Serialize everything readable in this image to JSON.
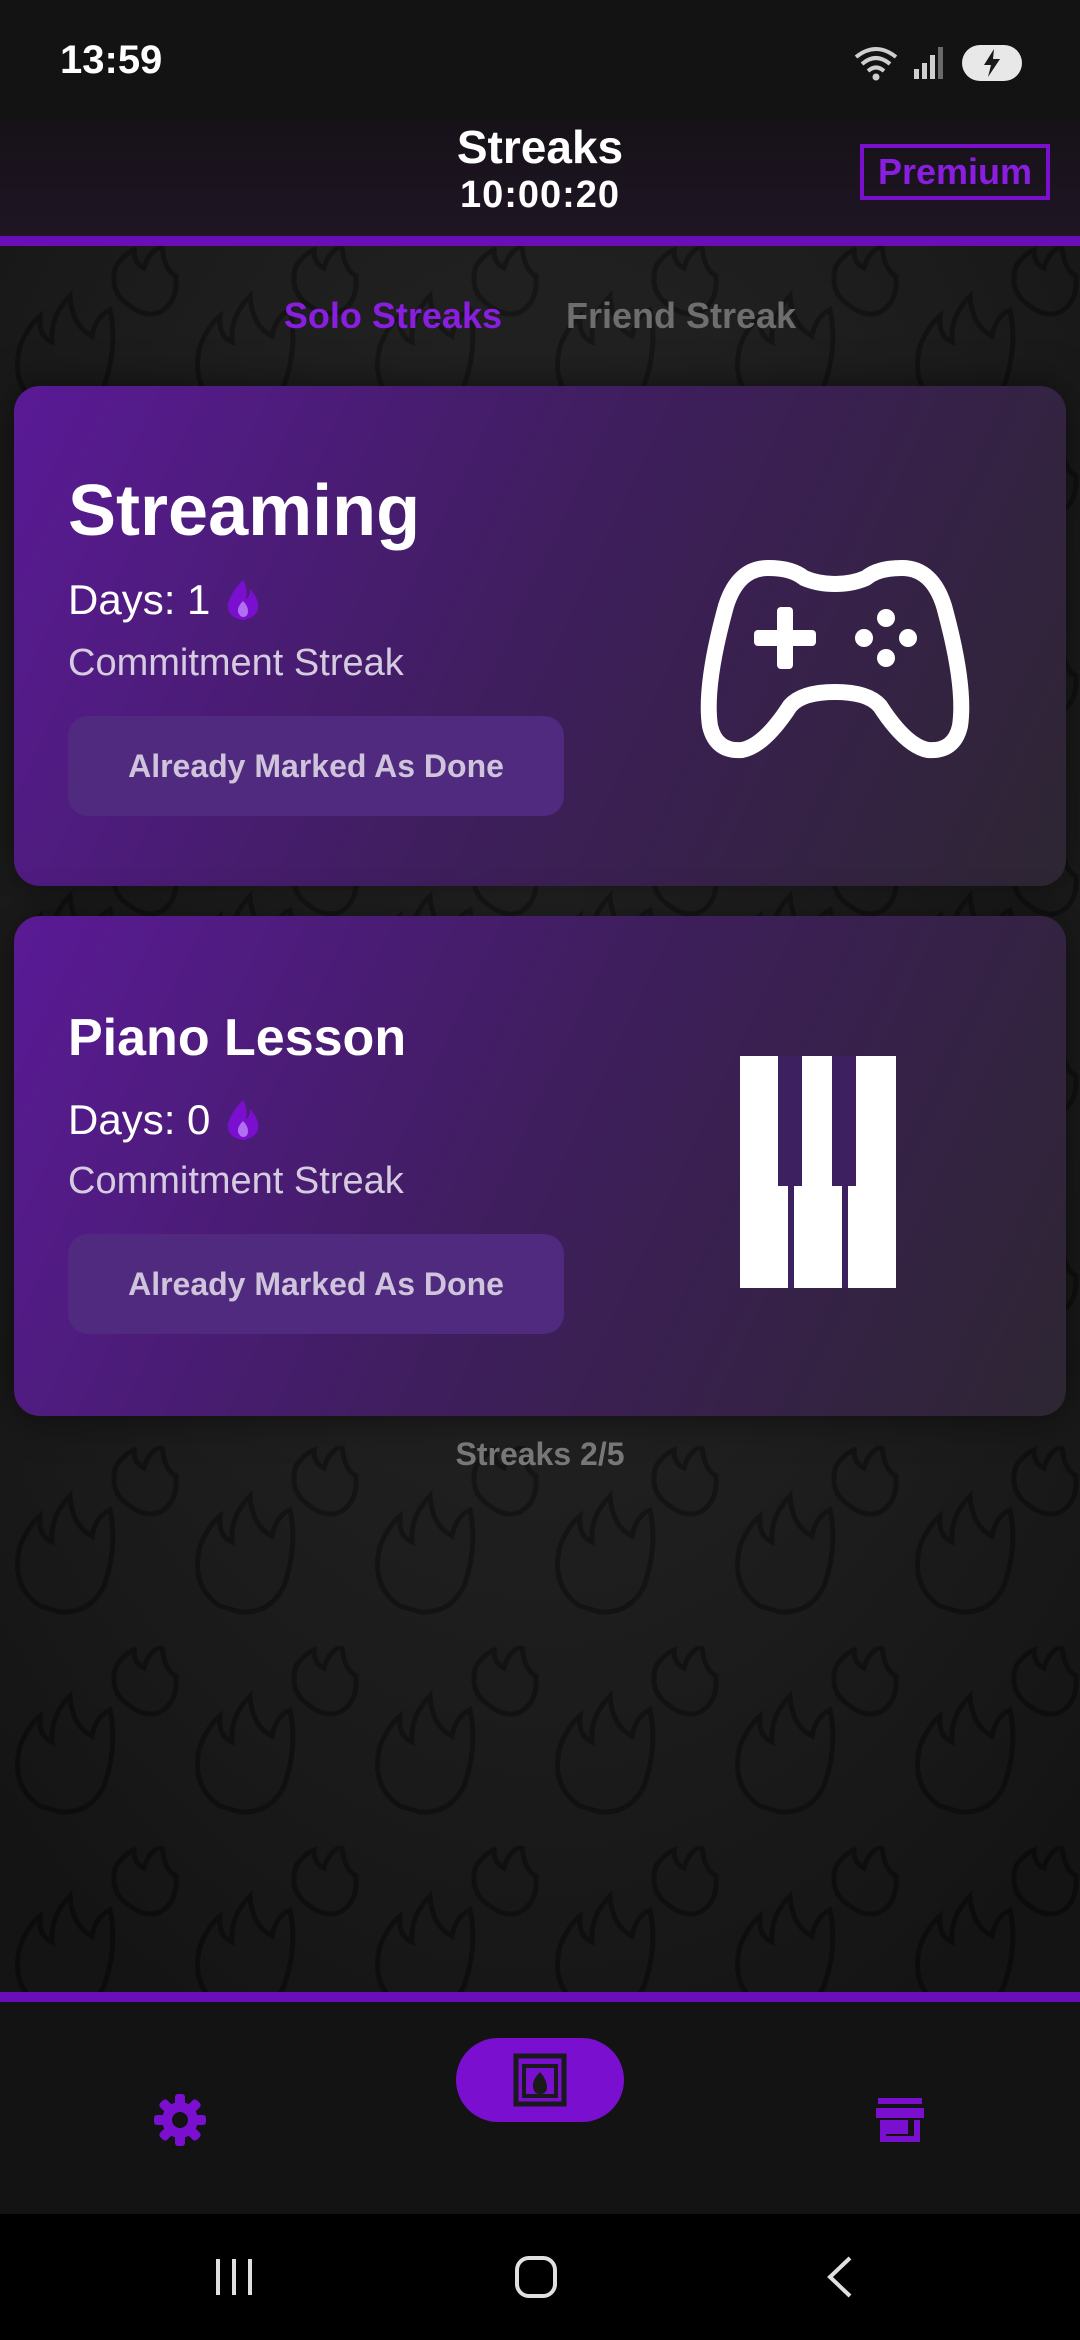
{
  "status_bar": {
    "time": "13:59",
    "icons": [
      "wifi-icon",
      "signal-icon",
      "battery-charging-icon"
    ]
  },
  "header": {
    "title": "Streaks",
    "timer": "10:00:20",
    "premium_label": "Premium"
  },
  "tabs": [
    {
      "label": "Solo Streaks",
      "active": true
    },
    {
      "label": "Friend Streak",
      "active": false
    }
  ],
  "streaks": [
    {
      "title": "Streaming",
      "days_text": "Days: 1",
      "type": "Commitment Streak",
      "button_label": "Already Marked As Done",
      "icon": "gamepad-icon"
    },
    {
      "title": "Piano Lesson",
      "days_text": "Days: 0",
      "type": "Commitment Streak",
      "button_label": "Already Marked As Done",
      "icon": "piano-icon"
    }
  ],
  "streak_count": "Streaks 2/5",
  "bottom_nav": [
    "settings-icon",
    "fireplace-icon",
    "store-icon"
  ],
  "colors": {
    "accent": "#7a0fd0",
    "accent_text": "#8a1ee0",
    "card_start": "#5a1a96",
    "card_end": "#2d2632"
  }
}
